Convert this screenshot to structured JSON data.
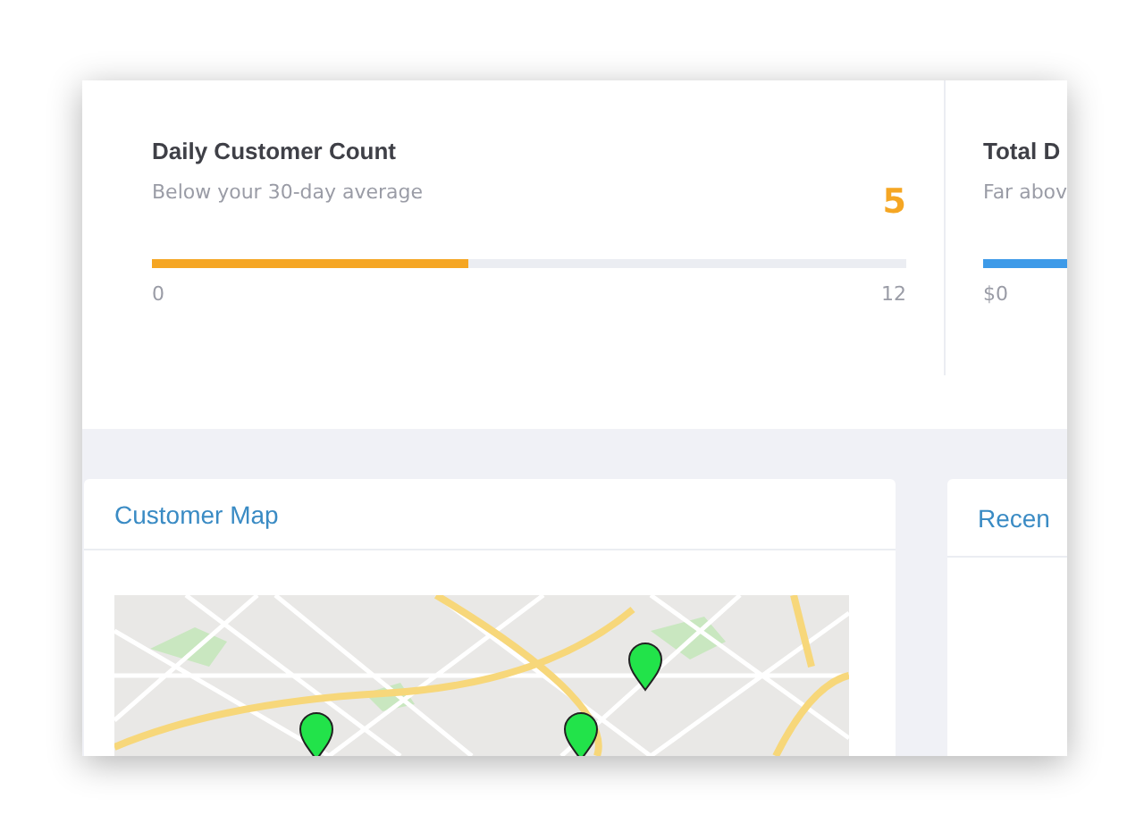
{
  "stats": [
    {
      "title": "Daily Customer Count",
      "subtitle": "Below your 30-day average",
      "value": "5",
      "color": "#f5a623",
      "level": 0.42,
      "min_label": "0",
      "max_label": "12"
    },
    {
      "title": "Total D",
      "subtitle": "Far abov",
      "color": "#3d9ae8",
      "level": 0.5,
      "min_label": "$0"
    }
  ],
  "panels": [
    {
      "title": "Customer Map"
    },
    {
      "title": "Recen"
    }
  ]
}
